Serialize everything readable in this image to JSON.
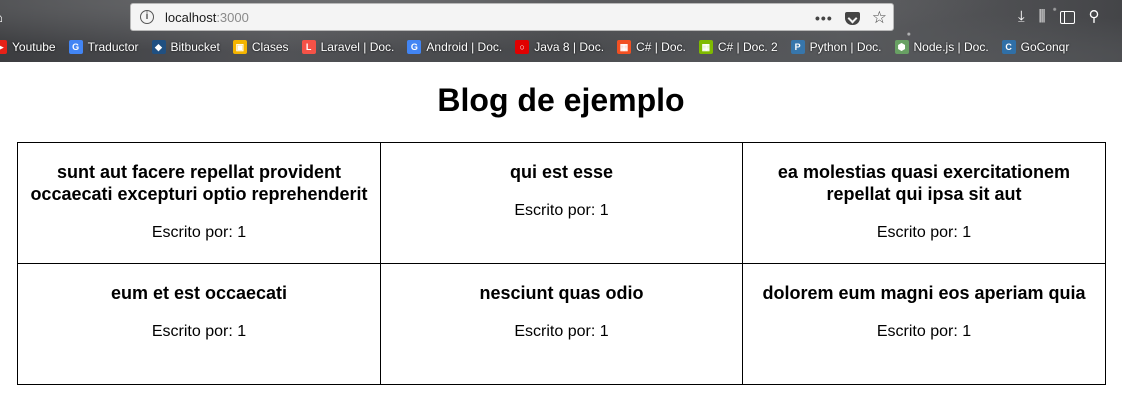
{
  "browser": {
    "url": {
      "host": "localhost",
      "port": ":3000"
    },
    "bookmarks": [
      {
        "label": "Youtube",
        "icon": "youtube-icon",
        "color": "#e62117",
        "glyph": "▶"
      },
      {
        "label": "Traductor",
        "icon": "google-translate-icon",
        "color": "#4285f4",
        "glyph": "G"
      },
      {
        "label": "Bitbucket",
        "icon": "bitbucket-icon",
        "color": "#205081",
        "glyph": "◆"
      },
      {
        "label": "Clases",
        "icon": "classroom-icon",
        "color": "#f4b400",
        "glyph": "▣"
      },
      {
        "label": "Laravel | Doc.",
        "icon": "laravel-icon",
        "color": "#f55247",
        "glyph": "L"
      },
      {
        "label": "Android | Doc.",
        "icon": "google-icon",
        "color": "#4285f4",
        "glyph": "G"
      },
      {
        "label": "Java 8 | Doc.",
        "icon": "oracle-icon",
        "color": "#e00000",
        "glyph": "○"
      },
      {
        "label": "C# | Doc.",
        "icon": "microsoft-icon",
        "color": "#f25022",
        "glyph": "▦"
      },
      {
        "label": "C# | Doc. 2",
        "icon": "microsoft-icon",
        "color": "#7fba00",
        "glyph": "▦"
      },
      {
        "label": "Python | Doc.",
        "icon": "python-icon",
        "color": "#3776ab",
        "glyph": "P"
      },
      {
        "label": "Node.js | Doc.",
        "icon": "nodejs-icon",
        "color": "#68a063",
        "glyph": "⬢"
      },
      {
        "label": "GoConqr",
        "icon": "goconqr-icon",
        "color": "#2f6fa7",
        "glyph": "C"
      }
    ]
  },
  "page": {
    "title": "Blog de ejemplo",
    "author_label": "Escrito por:",
    "posts": [
      {
        "title": "sunt aut facere repellat provident occaecati excepturi optio reprehenderit",
        "author": "1"
      },
      {
        "title": "qui est esse",
        "author": "1"
      },
      {
        "title": "ea molestias quasi exercitationem repellat qui ipsa sit aut",
        "author": "1"
      },
      {
        "title": "eum et est occaecati",
        "author": "1"
      },
      {
        "title": "nesciunt quas odio",
        "author": "1"
      },
      {
        "title": "dolorem eum magni eos aperiam quia",
        "author": "1"
      }
    ]
  }
}
